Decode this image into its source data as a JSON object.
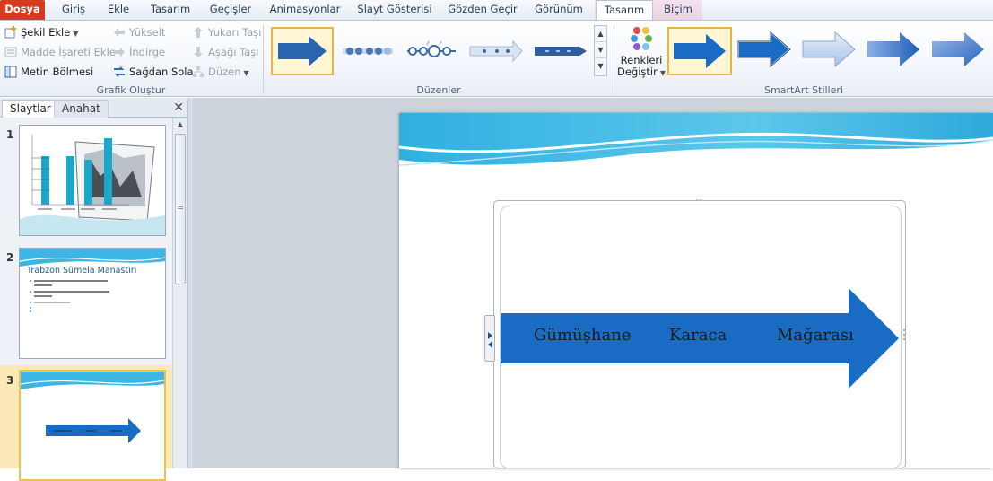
{
  "tabs": [
    {
      "label": "Dosya"
    },
    {
      "label": "Giriş"
    },
    {
      "label": "Ekle"
    },
    {
      "label": "Tasarım"
    },
    {
      "label": "Geçişler"
    },
    {
      "label": "Animasyonlar"
    },
    {
      "label": "Slayt Gösterisi"
    },
    {
      "label": "Gözden Geçir"
    },
    {
      "label": "Görünüm"
    },
    {
      "label": "Tasarım"
    },
    {
      "label": "Biçim"
    }
  ],
  "active_tab": "Tasarım (SmartArt Araçları)",
  "ribbon": {
    "create_graphic": {
      "label": "Grafik Oluştur",
      "add_shape": "Şekil Ekle",
      "add_bullet": "Madde İşareti Ekle",
      "text_pane": "Metin Bölmesi",
      "promote": "Yükselt",
      "demote": "İndirge",
      "right_to_left": "Sağdan Sola",
      "move_up": "Yukarı Taşı",
      "move_down": "Aşağı Taşı",
      "layout": "Düzen"
    },
    "layouts": {
      "label": "Düzenler"
    },
    "styles": {
      "label": "SmartArt Stilleri",
      "change_colors_line1": "Renkleri",
      "change_colors_line2": "Değiştir"
    }
  },
  "pane": {
    "tab_slides": "Slaytlar",
    "tab_outline": "Anahat",
    "close": "✕"
  },
  "slides": [
    {
      "number": "1"
    },
    {
      "number": "2",
      "title": "Trabzon Sümela Manastırı"
    },
    {
      "number": "3"
    }
  ],
  "smartart": {
    "items": [
      "Gümüşhane",
      "Karaca",
      "Mağarası"
    ]
  },
  "colors": {
    "arrow": "#1a6bc4",
    "file_tab": "#d53b1f",
    "selection": "#f2c14a"
  }
}
